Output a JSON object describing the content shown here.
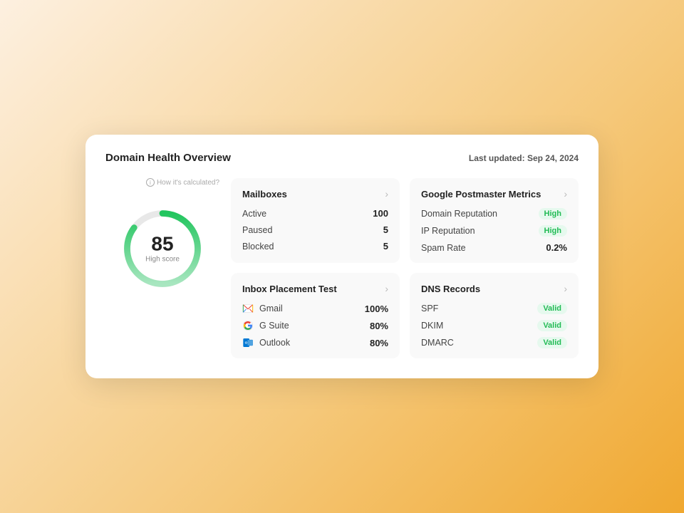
{
  "card": {
    "title": "Domain Health Overview",
    "last_updated_label": "Last updated:",
    "last_updated_date": "Sep 24, 2024"
  },
  "score": {
    "value": "85",
    "label": "High score",
    "percent": 85,
    "how_calculated": "How it's calculated?"
  },
  "mailboxes": {
    "title": "Mailboxes",
    "rows": [
      {
        "label": "Active",
        "value": "100"
      },
      {
        "label": "Paused",
        "value": "5"
      },
      {
        "label": "Blocked",
        "value": "5"
      }
    ]
  },
  "postmaster": {
    "title": "Google Postmaster Metrics",
    "rows": [
      {
        "label": "Domain Reputation",
        "value": "High",
        "type": "badge-high"
      },
      {
        "label": "IP Reputation",
        "value": "High",
        "type": "badge-high"
      },
      {
        "label": "Spam Rate",
        "value": "0.2%",
        "type": "text"
      }
    ]
  },
  "inbox_placement": {
    "title": "Inbox Placement Test",
    "rows": [
      {
        "label": "Gmail",
        "value": "100%",
        "icon": "gmail"
      },
      {
        "label": "G Suite",
        "value": "80%",
        "icon": "gsuite"
      },
      {
        "label": "Outlook",
        "value": "80%",
        "icon": "outlook"
      }
    ]
  },
  "dns": {
    "title": "DNS Records",
    "rows": [
      {
        "label": "SPF",
        "value": "Valid",
        "type": "badge-valid"
      },
      {
        "label": "DKIM",
        "value": "Valid",
        "type": "badge-valid"
      },
      {
        "label": "DMARC",
        "value": "Valid",
        "type": "badge-valid"
      }
    ]
  }
}
